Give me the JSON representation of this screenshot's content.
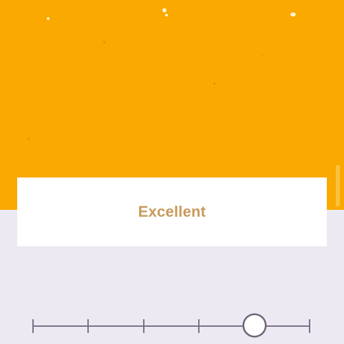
{
  "rating": {
    "label": "Excellent",
    "label_color": "#c79a5c"
  },
  "colors": {
    "hero_background": "#f9a900",
    "page_background": "#ece9f2",
    "card_background": "#ffffff",
    "slider_track": "#7a6f88",
    "slider_thumb": "#ffffff"
  },
  "slider": {
    "steps": 6,
    "selected_index": 4
  }
}
